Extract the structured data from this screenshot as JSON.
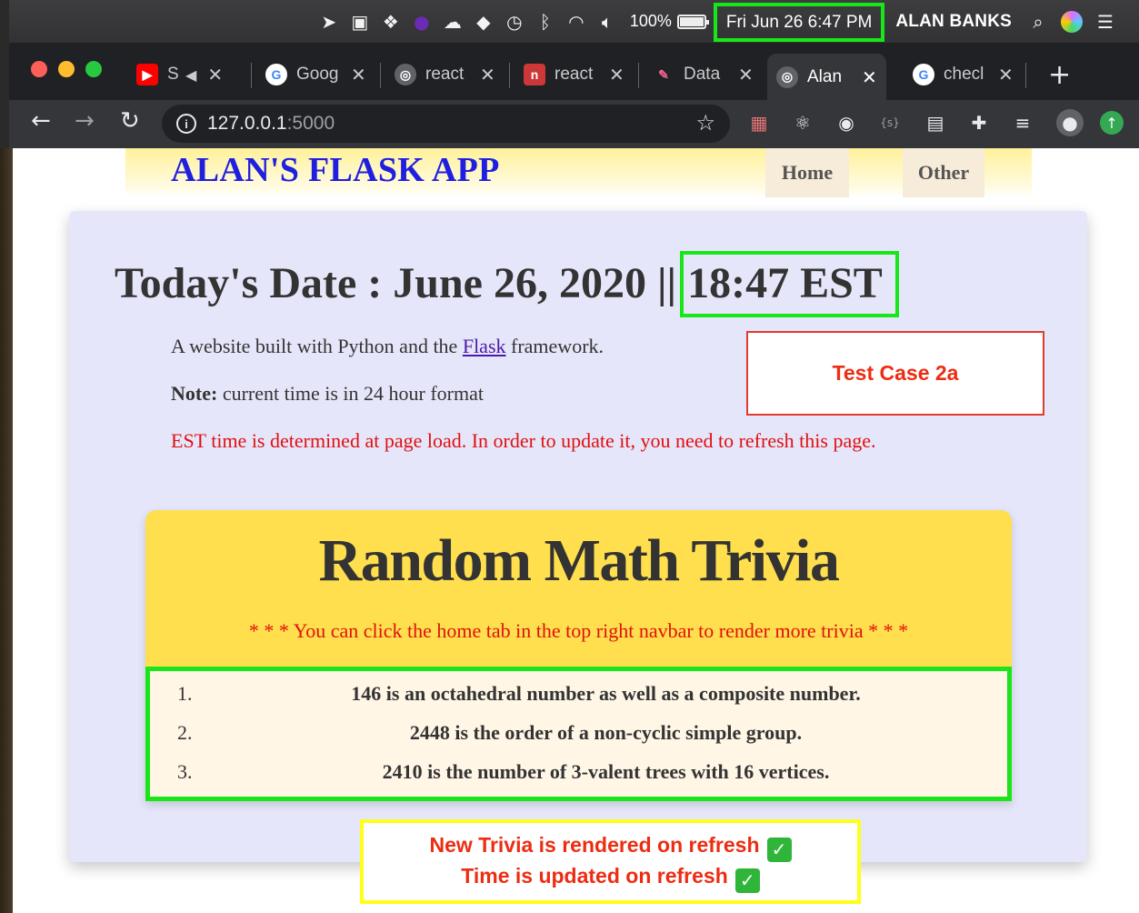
{
  "menubar": {
    "battery": "100%",
    "clock": "Fri Jun 26  6:47 PM",
    "user": "ALAN BANKS"
  },
  "tabs": [
    {
      "title": "S",
      "icon": "youtube-icon",
      "color": "#ff0000",
      "glyph": "▶"
    },
    {
      "title": "Goog",
      "icon": "google-icon",
      "color": "#ffffff",
      "glyph": "G"
    },
    {
      "title": "react",
      "icon": "globe-icon",
      "color": "#5f6368",
      "glyph": "◎"
    },
    {
      "title": "react",
      "icon": "npm-icon",
      "color": "#cb3837",
      "glyph": "n"
    },
    {
      "title": "Data",
      "icon": "pen-icon",
      "color": "#35363a",
      "glyph": "✎"
    },
    {
      "title": "Alan",
      "icon": "globe-icon",
      "color": "#5f6368",
      "glyph": "◎"
    },
    {
      "title": "checl",
      "icon": "google-icon",
      "color": "#ffffff",
      "glyph": "G"
    }
  ],
  "address_bar": {
    "host": "127.0.0.1",
    "port": ":5000"
  },
  "site": {
    "brand": "ALAN'S FLASK APP",
    "nav": [
      "Home",
      "Other"
    ]
  },
  "main": {
    "date_label": "Today's Date : June 26, 2020 ||",
    "time": "18:47 EST",
    "intro_before": "A website built with Python and the ",
    "intro_link": "Flask",
    "intro_after": " framework.",
    "note_label": "Note:",
    "note_text": " current time is in 24 hour format",
    "warning": "EST time is determined at page load. In order to update it, you need to refresh this page."
  },
  "annotations": {
    "test_case": "Test Case 2a",
    "refresh_line1": "New Trivia is rendered on refresh",
    "refresh_line2": "Time is updated on refresh",
    "check_glyph": "✓"
  },
  "trivia": {
    "title": "Random Math Trivia",
    "subtitle": "* * * You can click the home tab in the top right navbar to render more trivia * * *",
    "items": [
      {
        "num": "1.",
        "fact": "146 is an octahedral number as well as a composite number."
      },
      {
        "num": "2.",
        "fact": "2448 is the order of a non-cyclic simple group."
      },
      {
        "num": "3.",
        "fact": "2410 is the number of 3-valent trees with 16 vertices."
      }
    ]
  },
  "colors": {
    "brand_blue": "#1f1fe0",
    "highlight_green": "#19e619",
    "alert_red": "#ee2c12",
    "trivia_yellow": "#ffdf4d",
    "card_lavender": "#e6e6fa"
  }
}
